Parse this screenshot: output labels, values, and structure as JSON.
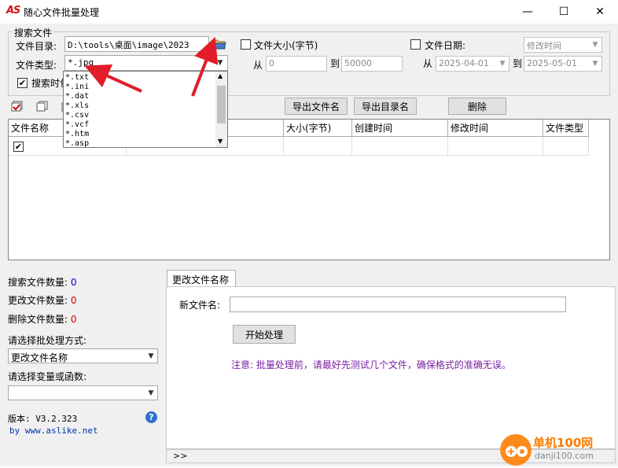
{
  "window": {
    "logo": "AS",
    "title": "随心文件批量处理",
    "minimize": "—",
    "maximize": "☐",
    "close": "✕"
  },
  "search": {
    "group_title": "搜索文件",
    "dir_label": "文件目录:",
    "dir_value": "D:\\tools\\桌面\\image\\2023",
    "type_label": "文件类型:",
    "type_value": "*.jpg",
    "search_time_label": "搜索时包",
    "size_label": "文件大小(字节)",
    "size_from_label": "从",
    "size_from": "0",
    "size_to_label": "到",
    "size_to": "50000",
    "date_label": "文件日期:",
    "date_mode": "修改时间",
    "date_from_label": "从",
    "date_from": "2025-04-01",
    "date_to_label": "到",
    "date_to": "2025-05-01"
  },
  "filetype_options": [
    "*.txt",
    "*.ini",
    "*.dat",
    "*.xls",
    "*.csv",
    "*.vcf",
    "*.htm",
    "*.asp"
  ],
  "toolbar": {
    "export_files": "导出文件名",
    "export_dirs": "导出目录名",
    "delete": "删除"
  },
  "table": {
    "columns": [
      "文件名称",
      "大小(字节)",
      "创建时间",
      "修改时间",
      "文件类型"
    ]
  },
  "stats": {
    "searched_label": "搜索文件数量:",
    "searched": "0",
    "renamed_label": "更改文件数量:",
    "renamed": "0",
    "deleted_label": "删除文件数量:",
    "deleted": "0"
  },
  "batch": {
    "mode_label": "请选择批处理方式:",
    "mode_value": "更改文件名称",
    "var_label": "请选择变量或函数:",
    "var_value": ""
  },
  "version": {
    "label": "版本: V3.2.323",
    "site": "by www.aslike.net"
  },
  "rename": {
    "tab": "更改文件名称",
    "new_name_label": "新文件名:",
    "new_name_value": "",
    "start_button": "开始处理",
    "note": "注意: 批量处理前，请最好先测试几个文件，确保格式的准确无误。",
    "expand": ">>"
  },
  "watermark": {
    "name": "单机100网",
    "url": "danji100.com"
  },
  "colors": {
    "accent_red": "#d8121b",
    "arrow_red": "#e11d2a",
    "note_purple": "#7a1fa2",
    "link_blue": "#0033aa"
  }
}
